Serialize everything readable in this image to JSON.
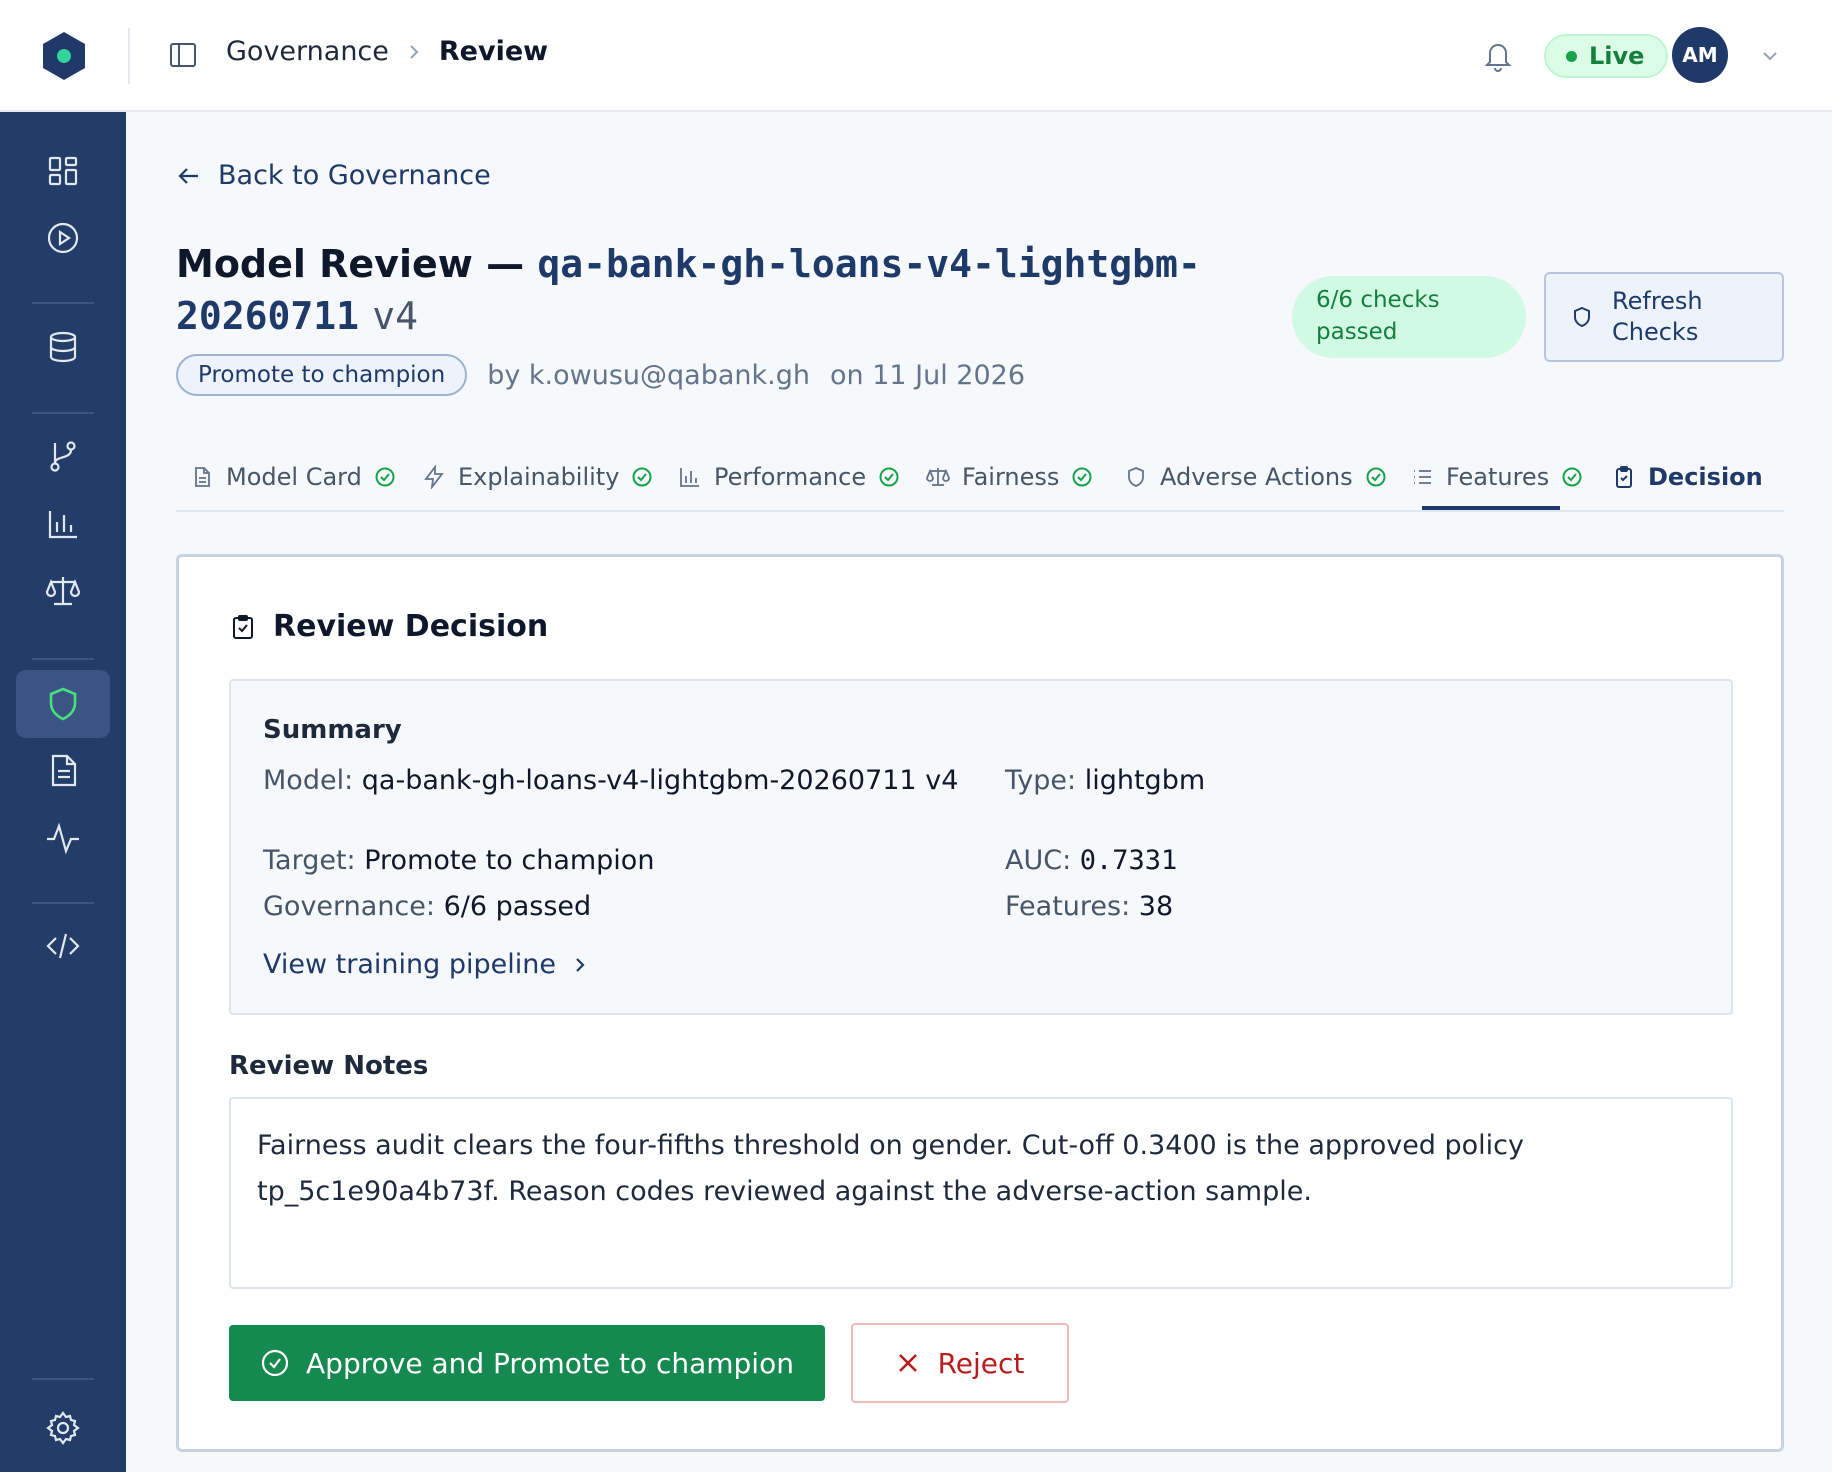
{
  "header": {
    "breadcrumb": [
      "Governance",
      "Review"
    ],
    "status": "Live",
    "user_initials": "AM"
  },
  "page": {
    "back_link": "Back to Governance",
    "title_prefix": "Model Review — ",
    "model_id": "qa-bank-gh-loans-v4-lightgbm-20260711",
    "version": "v4",
    "target_badge": "Promote to champion",
    "author": "by k.owusu@qabank.gh",
    "date": "on 11 Jul 2026",
    "checks_badge": "6/6 checks passed",
    "refresh_button": "Refresh Checks"
  },
  "tabs": [
    {
      "label": "Model Card",
      "icon": "file-icon",
      "passed": true
    },
    {
      "label": "Explainability",
      "icon": "bolt-icon",
      "passed": true
    },
    {
      "label": "Performance",
      "icon": "bar-chart-icon",
      "passed": true
    },
    {
      "label": "Fairness",
      "icon": "scale-icon",
      "passed": true
    },
    {
      "label": "Adverse Actions",
      "icon": "shield-icon",
      "passed": true
    },
    {
      "label": "Features",
      "icon": "list-icon",
      "passed": true
    },
    {
      "label": "Decision",
      "icon": "clipboard-check-icon",
      "passed": false,
      "active": true
    }
  ],
  "decision": {
    "title": "Review Decision",
    "summary_heading": "Summary",
    "model_label": "Model:",
    "model_value": "qa-bank-gh-loans-v4-lightgbm-20260711",
    "model_version": "v4",
    "type_label": "Type:",
    "type_value": "lightgbm",
    "target_label": "Target:",
    "target_value": "Promote to champion",
    "auc_label": "AUC:",
    "auc_value": "0.7331",
    "governance_label": "Governance:",
    "governance_value": "6/6 passed",
    "features_label": "Features:",
    "features_value": "38",
    "pipeline_link": "View training pipeline",
    "notes_label": "Review Notes",
    "notes_text": "Fairness audit clears the four-fifths threshold on gender. Cut-off 0.3400 is the approved policy tp_5c1e90a4b73f. Reason codes reviewed against the adverse-action sample.",
    "approve_button": "Approve and Promote to champion",
    "reject_button": "Reject"
  },
  "colors": {
    "sidebar": "#243d68",
    "accent": "#1e3a68",
    "success": "#15894f",
    "danger": "#b91c1c",
    "brand_dot": "#34d399"
  }
}
